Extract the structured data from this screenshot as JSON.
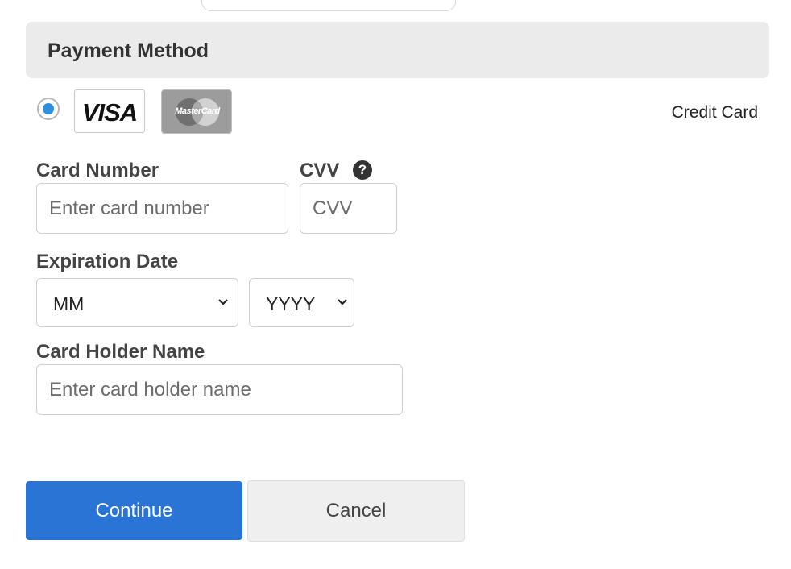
{
  "section": {
    "title": "Payment Method"
  },
  "payment_option": {
    "selected": true,
    "logos": [
      {
        "name": "visa",
        "text": "VISA"
      },
      {
        "name": "mastercard",
        "text": "MasterCard"
      }
    ],
    "label": "Credit Card"
  },
  "card_number": {
    "label": "Card Number",
    "placeholder": "Enter card number",
    "value": ""
  },
  "cvv": {
    "label": "CVV",
    "placeholder": "CVV",
    "value": "",
    "help_icon": "question-circle-icon"
  },
  "expiration": {
    "label": "Expiration Date",
    "month": {
      "selected": "MM"
    },
    "year": {
      "selected": "YYYY"
    }
  },
  "card_holder": {
    "label": "Card Holder Name",
    "placeholder": "Enter card holder name",
    "value": ""
  },
  "buttons": {
    "continue": "Continue",
    "cancel": "Cancel"
  },
  "colors": {
    "primary": "#2a74d6",
    "radio_selected": "#2f8fe0",
    "header_bg": "#ebebeb",
    "cancel_bg": "#efefef"
  }
}
